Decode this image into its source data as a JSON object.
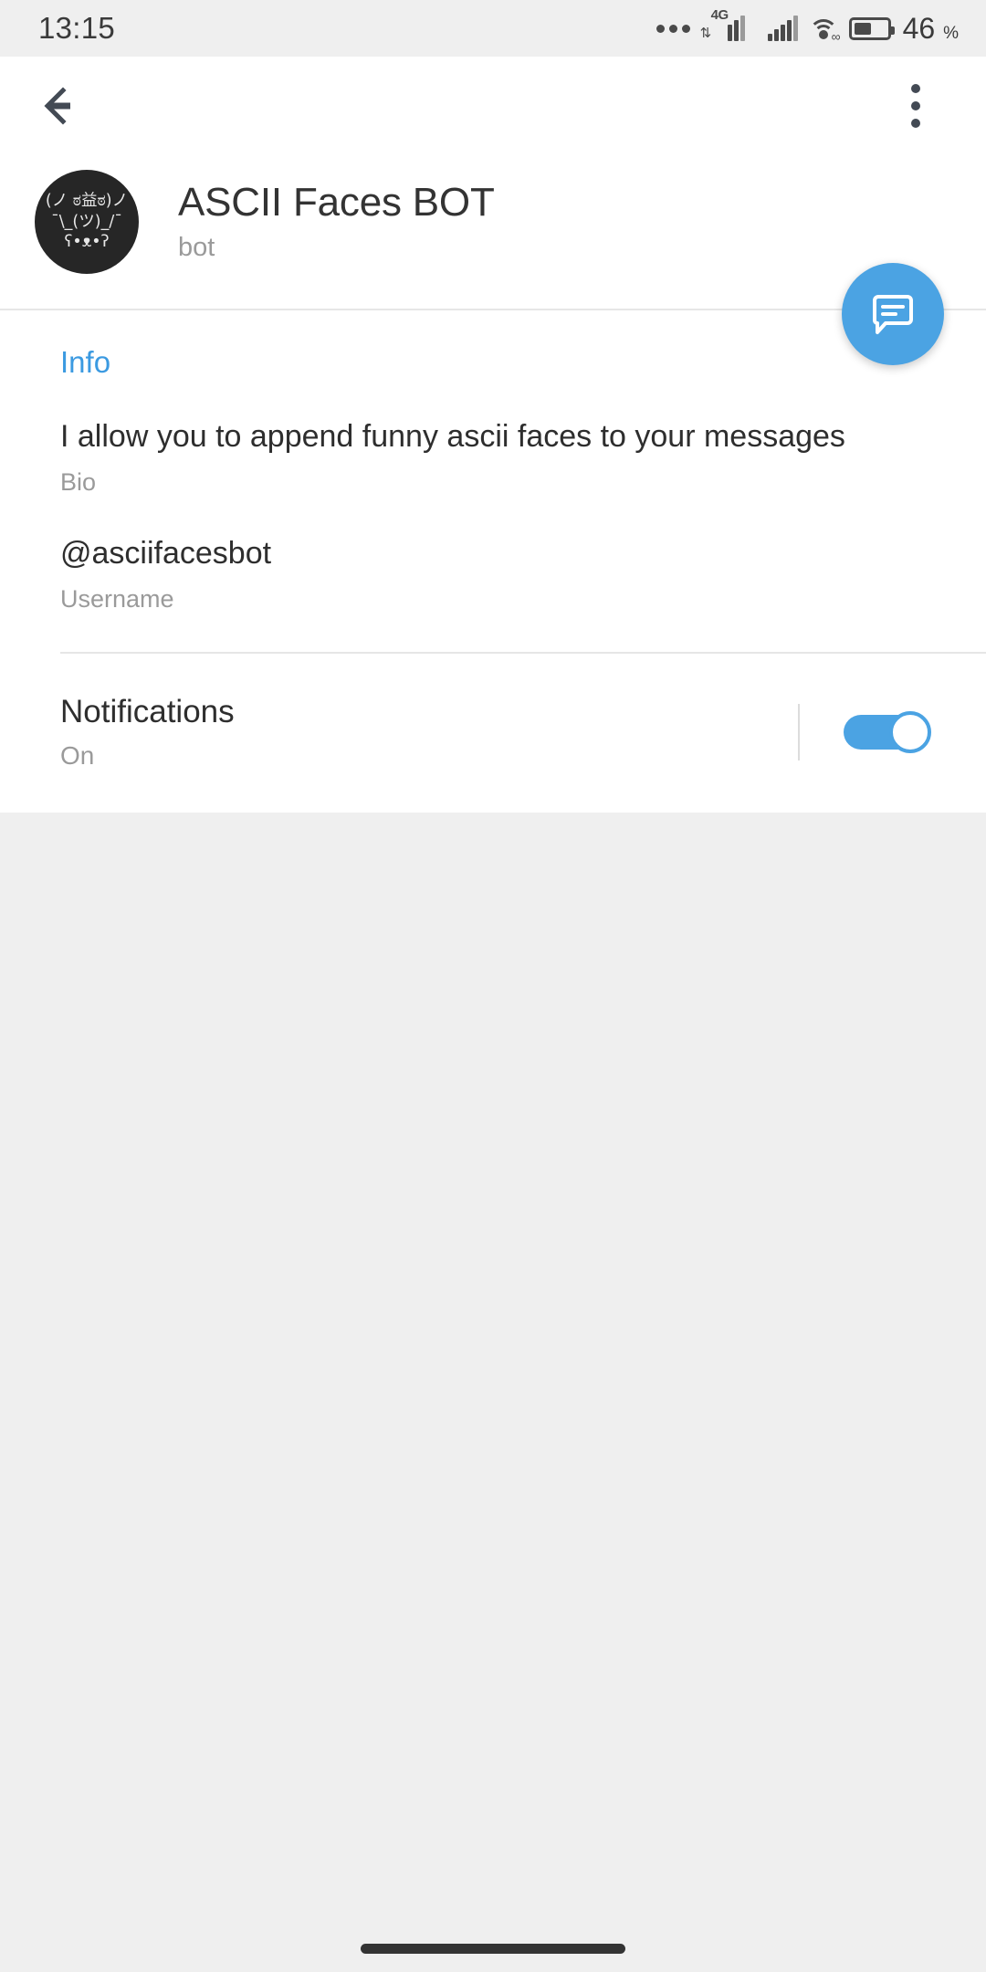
{
  "status_bar": {
    "time": "13:15",
    "network_label": "4G",
    "battery_percent": "46",
    "percent_symbol": "%",
    "icons": [
      "more-dots-icon",
      "signal-4g-icon",
      "signal-bars-icon",
      "wifi-icon",
      "battery-icon"
    ]
  },
  "toolbar": {
    "back_icon": "back-arrow-icon",
    "overflow_icon": "overflow-menu-icon"
  },
  "profile": {
    "avatar_art_line1": "(ノ ಠ益ಠ)ノ",
    "avatar_art_line2": "¯\\_(ツ)_/¯",
    "avatar_art_line3": "ʕ•ᴥ•ʔ",
    "title": "ASCII Faces BOT",
    "subtitle": "bot"
  },
  "fab": {
    "icon": "chat-bubble-icon",
    "color": "#4ba3e3"
  },
  "info": {
    "section_title": "Info",
    "accent_color": "#3b9ae1",
    "rows": [
      {
        "value": "I allow you to append funny ascii faces to your messages",
        "label": "Bio"
      },
      {
        "value": "@asciifacesbot",
        "label": "Username"
      }
    ]
  },
  "notifications": {
    "title": "Notifications",
    "state_label": "On",
    "toggle_on": true,
    "toggle_color": "#4ba3e3"
  }
}
